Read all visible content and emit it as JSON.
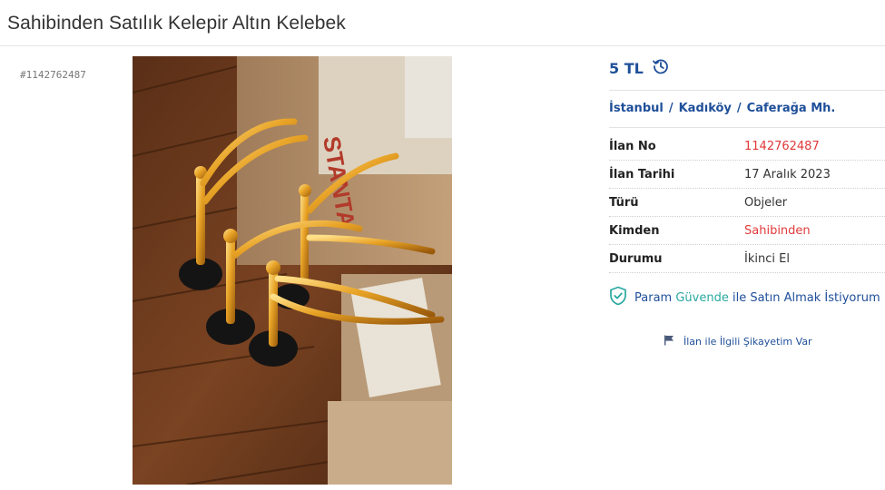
{
  "listing": {
    "title": "Sahibinden Satılık Kelepir Altın Kelebek",
    "id_label": "#1142762487",
    "photo_alt": "Altın kelebek ödülleri"
  },
  "price": {
    "amount": "5 TL",
    "history_icon": "price-history-icon"
  },
  "location": {
    "city": "İstanbul",
    "district": "Kadıköy",
    "neighborhood": "Caferağa Mh.",
    "separator": "/"
  },
  "details": [
    {
      "label": "İlan No",
      "value": "1142762487",
      "color": "#e03a3a"
    },
    {
      "label": "İlan Tarihi",
      "value": "17 Aralık 2023",
      "color": "#333333"
    },
    {
      "label": "Türü",
      "value": "Objeler",
      "color": "#333333"
    },
    {
      "label": "Kimden",
      "value": "Sahibinden",
      "color": "#e03a3a"
    },
    {
      "label": "Durumu",
      "value": "İkinci El",
      "color": "#333333"
    }
  ],
  "secure_payment": {
    "brand_1": "Param ",
    "brand_2": "Güvende",
    "rest": " ile Satın Almak İstiyorum",
    "icon": "shield-check-icon"
  },
  "complaint": {
    "label": "İlan ile İlgili Şikayetim Var",
    "icon": "flag-icon"
  },
  "colors": {
    "link_blue": "#1f4f99",
    "accent_red": "#e03a3a",
    "teal": "#2aa8a0"
  }
}
